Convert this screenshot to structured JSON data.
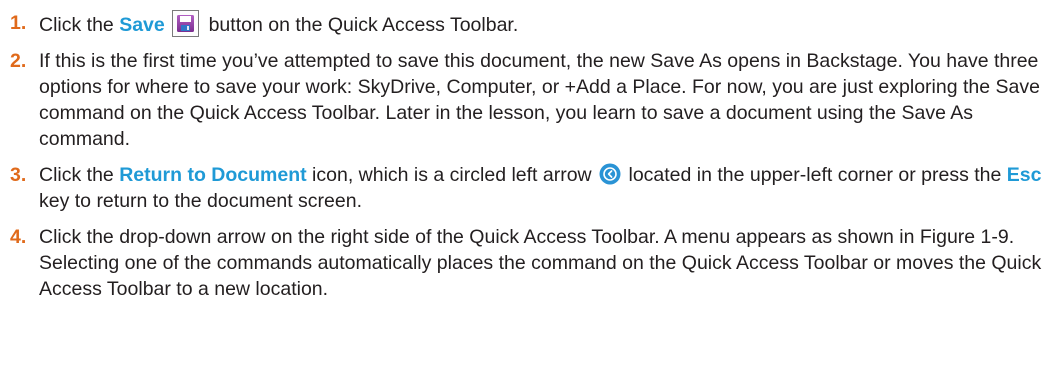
{
  "steps": [
    {
      "num": "1.",
      "t1": "Click the ",
      "save_label": "Save",
      "icon": "save-icon",
      "t2": " button on the Quick Access Toolbar."
    },
    {
      "num": "2.",
      "text": "If this is the first time you’ve attempted to save this document, the new Save As opens in Backstage. You have three options for where to save your work: SkyDrive, Computer, or +Add a Place. For now, you are just exploring the Save command on the Quick Access Toolbar. Later in the lesson, you learn to save a document using the Save As command."
    },
    {
      "num": "3.",
      "t1": "Click the ",
      "return_label": "Return to Document",
      "t2": " icon, which is a circled left arrow ",
      "icon": "return-arrow-icon",
      "t3": " located in the upper-left corner or press the ",
      "esc_label": "Esc",
      "t4": " key to return to the document screen."
    },
    {
      "num": "4.",
      "text": "Click the drop-down arrow on the right side of the Quick Access Toolbar. A menu appears as shown in Figure 1-9. Selecting one of the commands automatically places the command on the Quick Access Toolbar or moves the Quick Access Toolbar to a new location."
    }
  ],
  "colors": {
    "step_number": "#e06a1b",
    "highlight": "#1f9ad6",
    "body_text": "#231f20"
  }
}
